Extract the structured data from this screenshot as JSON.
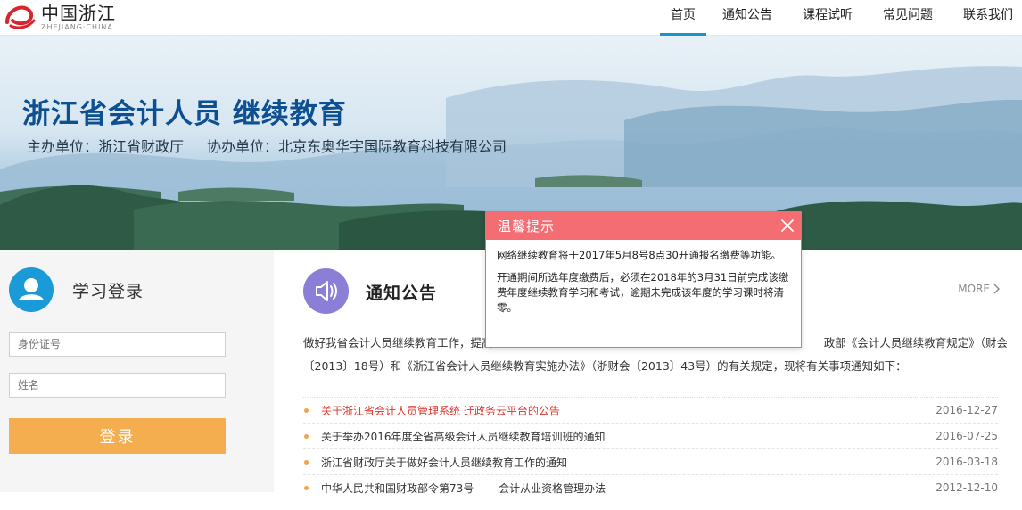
{
  "header": {
    "logo_cn": "中国浙江",
    "logo_en": "ZHEJIANG·CHINA",
    "nav": [
      {
        "label": "首页",
        "active": true
      },
      {
        "label": "通知公告",
        "active": false
      },
      {
        "label": "课程试听",
        "active": false
      },
      {
        "label": "常见问题",
        "active": false
      },
      {
        "label": "联系我们",
        "active": false
      }
    ]
  },
  "banner": {
    "title": "浙江省会计人员 继续教育",
    "host": "主办单位：浙江省财政厅",
    "co_host": "协办单位：北京东奥华宇国际教育科技有限公司"
  },
  "login": {
    "title": "学习登录",
    "id_placeholder": "身份证号",
    "name_placeholder": "姓名",
    "button_label": "登录"
  },
  "notice": {
    "title": "通知公告",
    "more_label": "MORE",
    "intro": "做好我省会计人员继续教育工作，提高会计人员素质，根据财政部《会计人员继续教育规定》（财会〔2013〕18号）和《浙江省会计人员继续教育实施办法》（浙财会〔2013〕43号）的有关规定，现将有关事项通知如下：",
    "intro_visible_prefix": "做好我省会计人员继续教育工作，提高",
    "intro_visible_mid": "政部《会计人员继续教育规定》（财会",
    "intro_line2": "〔2013〕18号）和《浙江省会计人员继续教育实施办法》（浙财会〔2013〕43号）的有关规定，现将有关事项通知如下：",
    "items": [
      {
        "title": "关于浙江省会计人员管理系统 迁政务云平台的公告",
        "date": "2016-12-27",
        "hot": true
      },
      {
        "title": "关于举办2016年度全省高级会计人员继续教育培训班的通知",
        "date": "2016-07-25",
        "hot": false
      },
      {
        "title": "浙江省财政厅关于做好会计人员继续教育工作的通知",
        "date": "2016-03-18",
        "hot": false
      },
      {
        "title": "中华人民共和国财政部令第73号 ——会计从业资格管理办法",
        "date": "2012-12-10",
        "hot": false
      }
    ]
  },
  "modal": {
    "title": "温馨提示",
    "line1": "网络继续教育将于2017年5月8号8点30开通报名缴费等功能。",
    "line2": "开通期间所选年度缴费后，必须在2018年的3月31日前完成该缴费年度继续教育学习和考试，逾期未完成该年度的学习课时将清零。"
  },
  "colors": {
    "nav_active": "#1496d2",
    "banner_title": "#0d4f91",
    "login_button": "#f4ad4f",
    "modal_header": "#f46d73",
    "hot_item": "#d9362b",
    "bullet": "#f0a34a"
  },
  "icons": [
    "logo-mark-icon",
    "user-icon",
    "speaker-icon",
    "chevron-right-icon",
    "close-icon"
  ]
}
